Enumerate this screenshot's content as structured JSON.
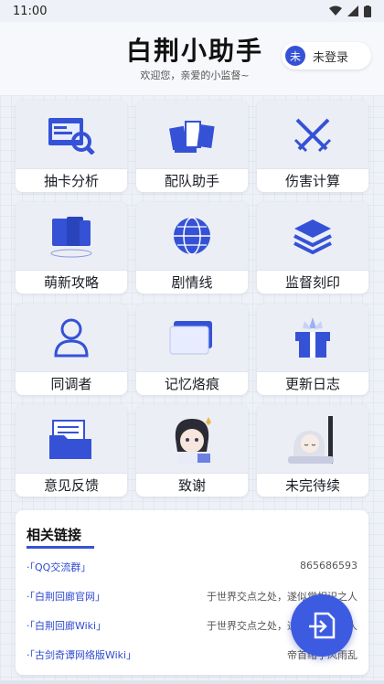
{
  "status": {
    "time": "11:00"
  },
  "header": {
    "app_title": "白荆小助手",
    "welcome": "欢迎您，亲爱的小监督~",
    "avatar_char": "未",
    "login_label": "未登录"
  },
  "tiles": [
    {
      "label": "抽卡分析",
      "icon": "card-analysis-icon"
    },
    {
      "label": "配队助手",
      "icon": "team-builder-icon"
    },
    {
      "label": "伤害计算",
      "icon": "crossed-swords-icon"
    },
    {
      "label": "萌新攻略",
      "icon": "books-icon"
    },
    {
      "label": "剧情线",
      "icon": "globe-icon"
    },
    {
      "label": "监督刻印",
      "icon": "layers-icon"
    },
    {
      "label": "同调者",
      "icon": "person-icon"
    },
    {
      "label": "记忆烙痕",
      "icon": "cards-icon"
    },
    {
      "label": "更新日志",
      "icon": "gift-box-icon"
    },
    {
      "label": "意见反馈",
      "icon": "folder-icon"
    },
    {
      "label": "致谢",
      "icon": "character-portrait-icon"
    },
    {
      "label": "未完待续",
      "icon": "character-sleeping-icon"
    }
  ],
  "links": {
    "title": "相关链接",
    "items": [
      {
        "name": "·「QQ交流群」",
        "desc": "865686593"
      },
      {
        "name": "·「白荆回廊官网」",
        "desc": "于世界交点之处，遂似觉相识之人"
      },
      {
        "name": "·「白荆回廊Wiki」",
        "desc": "于世界交点之处，遂似觉相识之人"
      },
      {
        "name": "·「古剑奇谭网络版Wiki」",
        "desc": "帝首绪于风雨乱"
      }
    ]
  },
  "colors": {
    "accent": "#3552d6",
    "link": "#2d4ad0"
  }
}
